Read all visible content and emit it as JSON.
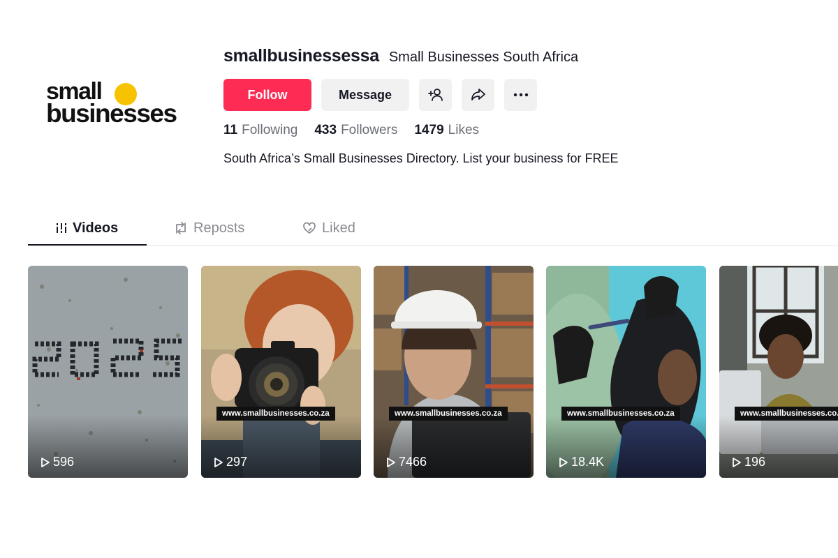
{
  "profile": {
    "logo_line1": "small",
    "logo_line2": "businesses",
    "username": "smallbusinessessa",
    "nickname": "Small Businesses South Africa",
    "bio": "South Africa’s Small Businesses Directory. List your business for FREE",
    "brand_color": "#f7c300"
  },
  "actions": {
    "follow_label": "Follow",
    "message_label": "Message",
    "add_friend_icon": "person-plus-icon",
    "share_icon": "share-arrow-icon",
    "more_icon": "ellipsis-icon",
    "follow_color": "#fe2c55"
  },
  "stats": {
    "following_count": "11",
    "following_label": "Following",
    "followers_count": "433",
    "followers_label": "Followers",
    "likes_count": "1479",
    "likes_label": "Likes"
  },
  "tabs": [
    {
      "label": "Videos",
      "icon": "grid-bars-icon",
      "active": true
    },
    {
      "label": "Reposts",
      "icon": "repost-icon",
      "active": false
    },
    {
      "label": "Liked",
      "icon": "heart-outline-icon",
      "active": false
    }
  ],
  "videos": [
    {
      "views": "596",
      "watermark": ""
    },
    {
      "views": "297",
      "watermark": "www.smallbusinesses.co.za"
    },
    {
      "views": "7466",
      "watermark": "www.smallbusinesses.co.za"
    },
    {
      "views": "18.4K",
      "watermark": "www.smallbusinesses.co.za"
    },
    {
      "views": "196",
      "watermark": "www.smallbusinesses.co.za"
    }
  ]
}
